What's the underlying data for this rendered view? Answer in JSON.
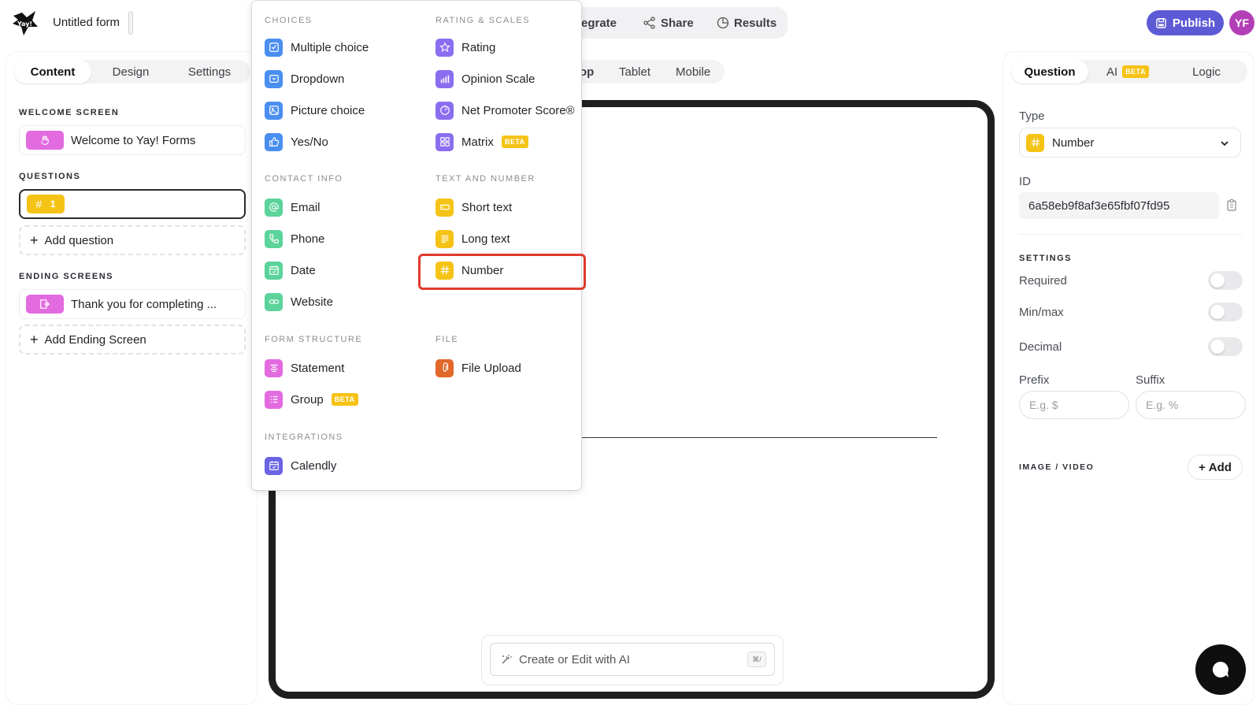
{
  "app": {
    "form_title": "Untitled form",
    "colors": {
      "accent": "#5d5ad6",
      "avatar": "#b33fb6",
      "highlight": "#e03a2c",
      "number": "#f5c316",
      "welcome_pink": "#e36be0"
    }
  },
  "header": {
    "nav": {
      "integrate": "egrate",
      "share": "Share",
      "results": "Results"
    },
    "publish": "Publish",
    "avatar": "YF"
  },
  "left": {
    "tabs": [
      "Content",
      "Design",
      "Settings"
    ],
    "welcome_label": "WELCOME SCREEN",
    "welcome_item": "Welcome to Yay! Forms",
    "questions_label": "QUESTIONS",
    "question_number": "1",
    "add_question": "Add question",
    "ending_label": "ENDING SCREENS",
    "ending_item": "Thank you for completing ...",
    "add_ending": "Add Ending Screen"
  },
  "menu": {
    "choices": {
      "heading": "CHOICES",
      "items": [
        "Multiple choice",
        "Dropdown",
        "Picture choice",
        "Yes/No"
      ]
    },
    "rating": {
      "heading": "RATING & SCALES",
      "items": [
        "Rating",
        "Opinion Scale",
        "Net Promoter Score®",
        "Matrix"
      ]
    },
    "contact": {
      "heading": "CONTACT INFO",
      "items": [
        "Email",
        "Phone",
        "Date",
        "Website"
      ]
    },
    "text": {
      "heading": "TEXT AND NUMBER",
      "items": [
        "Short text",
        "Long text",
        "Number"
      ]
    },
    "structure": {
      "heading": "FORM STRUCTURE",
      "items": [
        "Statement",
        "Group"
      ]
    },
    "file": {
      "heading": "FILE",
      "items": [
        "File Upload"
      ]
    },
    "integrations": {
      "heading": "INTEGRATIONS",
      "items": [
        "Calendly"
      ]
    },
    "beta": "BETA"
  },
  "center": {
    "device_tabs": [
      "op",
      "Tablet",
      "Mobile"
    ],
    "ai_placeholder": "Create or Edit with AI",
    "ai_shortcut": "⌘/"
  },
  "right": {
    "tabs": [
      "Question",
      "AI",
      "Logic"
    ],
    "ai_badge": "BETA",
    "type_label": "Type",
    "type_value": "Number",
    "id_label": "ID",
    "id_value": "6a58eb9f8af3e65fbf07fd95",
    "settings_label": "SETTINGS",
    "required": "Required",
    "minmax": "Min/max",
    "decimal": "Decimal",
    "prefix_label": "Prefix",
    "suffix_label": "Suffix",
    "prefix_placeholder": "E.g. $",
    "suffix_placeholder": "E.g. %",
    "media_label": "IMAGE / VIDEO",
    "add": "Add"
  }
}
